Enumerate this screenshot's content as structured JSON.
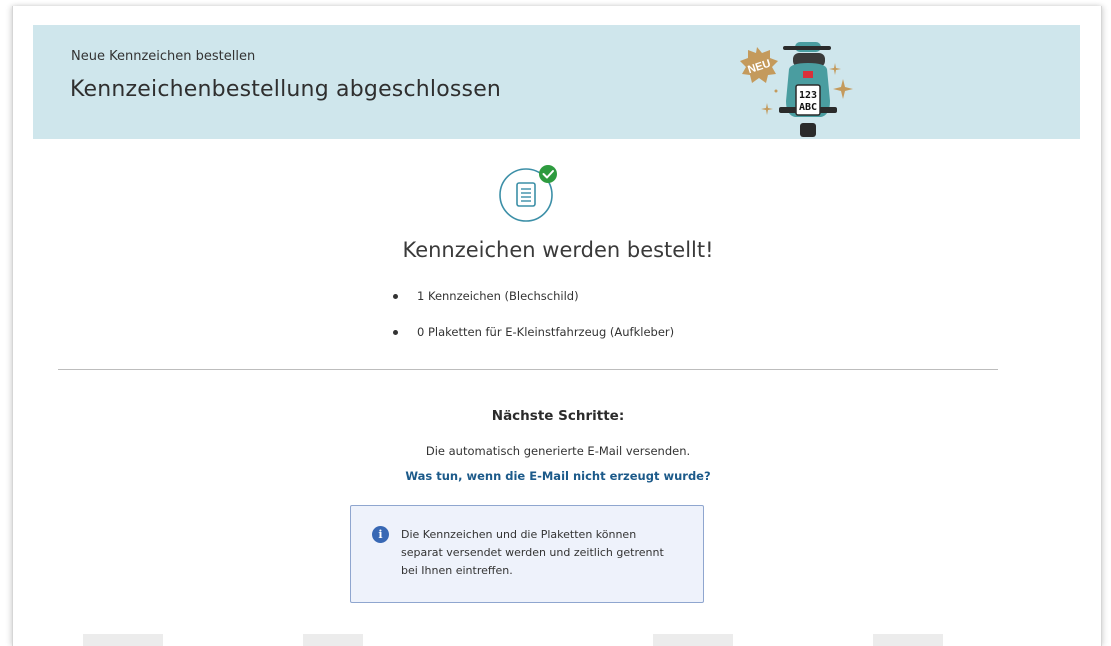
{
  "header": {
    "breadcrumb": "Neue Kennzeichen bestellen",
    "title": "Kennzeichenbestellung abgeschlossen",
    "badge_text": "NEU",
    "plate_line1": "123",
    "plate_line2": "ABC"
  },
  "status": {
    "heading": "Kennzeichen werden bestellt!",
    "items": [
      "1 Kennzeichen (Blechschild)",
      "0 Plaketten für E-Kleinstfahrzeug (Aufkleber)"
    ]
  },
  "next_steps": {
    "title": "Nächste Schritte:",
    "text": "Die automatisch generierte E-Mail versenden.",
    "link": "Was tun, wenn die E-Mail nicht erzeugt wurde?"
  },
  "info": {
    "icon_label": "i",
    "text": "Die Kennzeichen und die Plaketten können separat versendet werden und zeitlich getrennt bei Ihnen eintreffen."
  },
  "colors": {
    "banner": "#cfe6ec",
    "link": "#1c5a8a",
    "info_bg": "#eef2fb",
    "info_border": "#8fa6cf",
    "success": "#2e9b3f",
    "icon_teal": "#3c8fa7",
    "badge": "#c49a5c"
  },
  "icons": [
    "document-check-icon",
    "info-icon",
    "scooter-illustration"
  ]
}
